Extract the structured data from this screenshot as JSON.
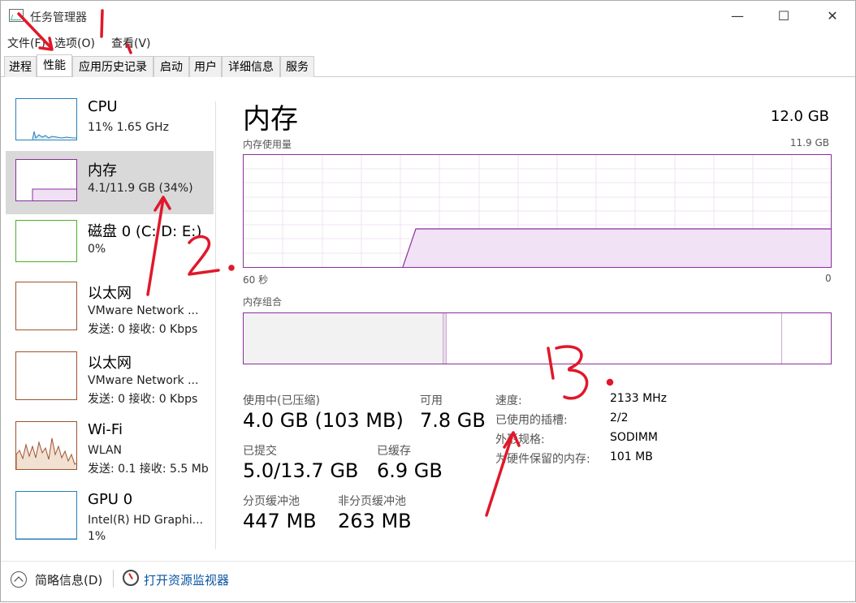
{
  "window": {
    "title": "任务管理器",
    "controls": {
      "minimize": "—",
      "maximize": "☐",
      "close": "✕"
    }
  },
  "menu": [
    "文件(F)",
    "选项(O)",
    "查看(V)"
  ],
  "tabs": [
    "进程",
    "性能",
    "应用历史记录",
    "启动",
    "用户",
    "详细信息",
    "服务"
  ],
  "active_tab": "性能",
  "sidebar": [
    {
      "title": "CPU",
      "sub": "11%  1.65 GHz",
      "sub2": "",
      "color": "#2a7fb8"
    },
    {
      "title": "内存",
      "sub": "4.1/11.9 GB (34%)",
      "sub2": "",
      "color": "#8b2f9c"
    },
    {
      "title": "磁盘 0 (C: D: E:)",
      "sub": "0%",
      "sub2": "",
      "color": "#4caf2a"
    },
    {
      "title": "以太网",
      "sub": "VMware Network ...",
      "sub2": "发送: 0  接收: 0 Kbps",
      "color": "#a0522d"
    },
    {
      "title": "以太网",
      "sub": "VMware Network ...",
      "sub2": "发送: 0  接收: 0 Kbps",
      "color": "#a0522d"
    },
    {
      "title": "Wi-Fi",
      "sub": "WLAN",
      "sub2": "发送: 0.1  接收: 5.5 Mb",
      "color": "#a0522d"
    },
    {
      "title": "GPU 0",
      "sub": "Intel(R) HD Graphi...",
      "sub2": "1%",
      "color": "#2a7fb8"
    }
  ],
  "main": {
    "title": "内存",
    "total": "12.0 GB",
    "usage_label": "内存使用量",
    "usage_max": "11.9 GB",
    "time_left": "60 秒",
    "time_right": "0",
    "composition_label": "内存组合",
    "stats": {
      "in_use_label": "使用中(已压缩)",
      "in_use_value": "4.0 GB (103 MB)",
      "available_label": "可用",
      "available_value": "7.8 GB",
      "committed_label": "已提交",
      "committed_value": "5.0/13.7 GB",
      "cached_label": "已缓存",
      "cached_value": "6.9 GB",
      "paged_label": "分页缓冲池",
      "paged_value": "447 MB",
      "nonpaged_label": "非分页缓冲池",
      "nonpaged_value": "263 MB"
    },
    "props": [
      {
        "key": "速度:",
        "value": "2133 MHz"
      },
      {
        "key": "已使用的插槽:",
        "value": "2/2"
      },
      {
        "key": "外形规格:",
        "value": "SODIMM"
      },
      {
        "key": "为硬件保留的内存:",
        "value": "101 MB"
      }
    ]
  },
  "bottom": {
    "fewer_details": "简略信息(D)",
    "open_monitor": "打开资源监视器"
  },
  "annotations": [
    "1",
    "2.",
    "3."
  ]
}
